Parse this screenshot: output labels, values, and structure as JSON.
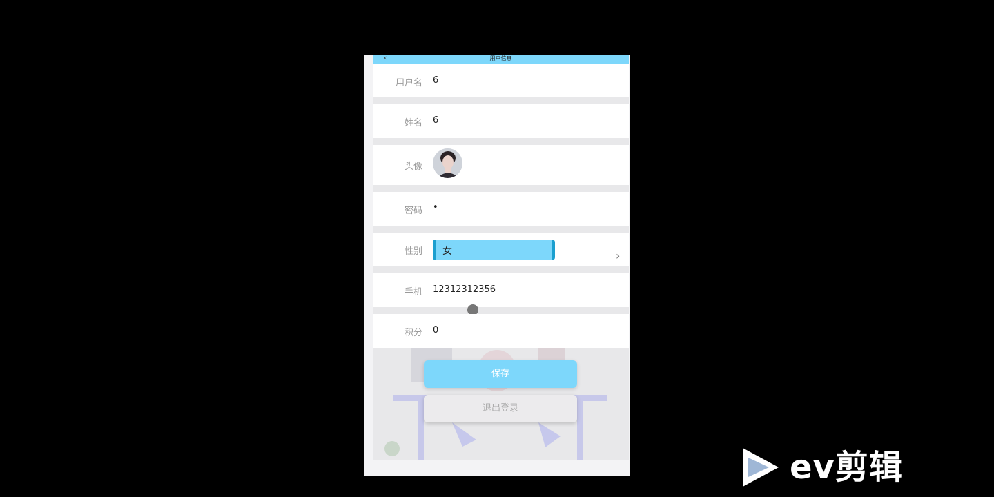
{
  "header": {
    "title": "用户信息",
    "back_icon": "chevron-left-icon"
  },
  "fields": {
    "username": {
      "label": "用户名",
      "value": "6"
    },
    "name": {
      "label": "姓名",
      "value": "6"
    },
    "avatar": {
      "label": "头像"
    },
    "password": {
      "label": "密码",
      "value": "•"
    },
    "gender": {
      "label": "性别",
      "value": "女"
    },
    "phone": {
      "label": "手机",
      "value": "12312312356"
    },
    "points": {
      "label": "积分",
      "value": "0"
    }
  },
  "buttons": {
    "save": "保存",
    "logout": "退出登录"
  },
  "watermark": {
    "text": "ev剪辑"
  },
  "colors": {
    "accent": "#7dd7fb",
    "accent_border": "#1b9fcf",
    "background": "#000000"
  }
}
